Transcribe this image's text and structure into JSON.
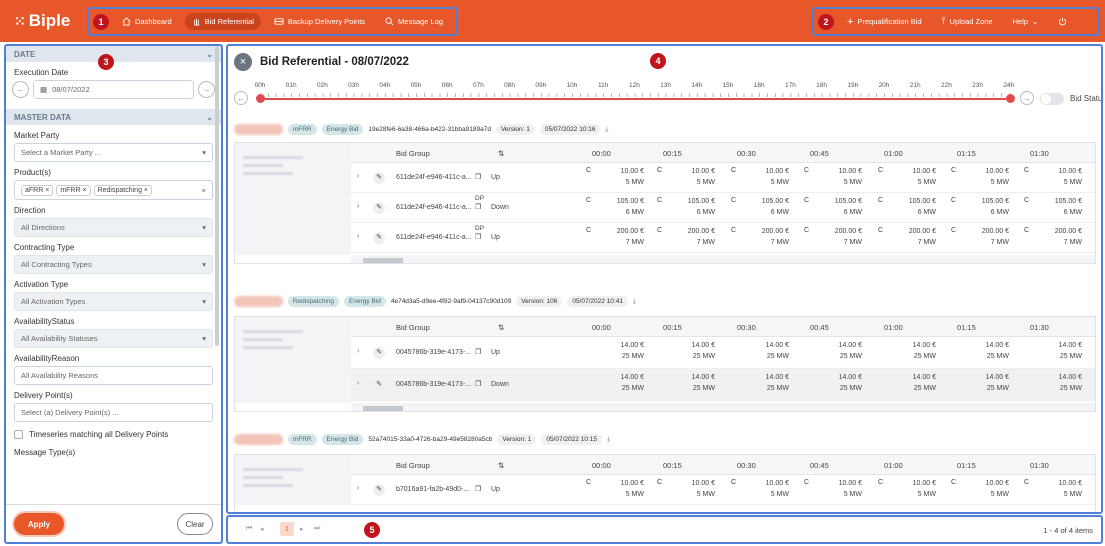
{
  "app": {
    "logo": "Biple",
    "accent": "#e8572a",
    "highlight": "#4f7fd8"
  },
  "nav_left": [
    {
      "label": "Dashboard",
      "icon": "home-icon",
      "active": false
    },
    {
      "label": "Bid Referential",
      "icon": "hand-icon",
      "active": true
    },
    {
      "label": "Backup Delivery Points",
      "icon": "truck-icon",
      "active": false
    },
    {
      "label": "Message Log",
      "icon": "search-icon",
      "active": false
    }
  ],
  "nav_right": [
    {
      "label": "Prequalification Bid",
      "icon": "plus-icon"
    },
    {
      "label": "Upload Zone",
      "icon": "upload-icon"
    },
    {
      "label": "Help",
      "icon": "chevron-down-icon"
    }
  ],
  "markers": [
    "1",
    "2",
    "3",
    "4",
    "5"
  ],
  "sidebar": {
    "date_section": "DATE",
    "execution_date_label": "Execution Date",
    "execution_date": "08/07/2022",
    "master_section": "MASTER DATA",
    "market_party_label": "Market Party",
    "market_party_placeholder": "Select a Market Party ...",
    "products_label": "Product(s)",
    "products": [
      "aFRR",
      "mFRR",
      "Redispatching"
    ],
    "direction_label": "Direction",
    "direction_value": "All Directions",
    "contracting_label": "Contracting Type",
    "contracting_value": "All Contracting Types",
    "activation_label": "Activation Type",
    "activation_value": "All Activation Types",
    "availability_status_label": "AvailabilityStatus",
    "availability_status_value": "All Availability Statuses",
    "availability_reason_label": "AvailabilityReason",
    "availability_reason_value": "All Availability Reasons",
    "delivery_label": "Delivery Point(s)",
    "delivery_placeholder": "Select (a) Delivery Point(s) ...",
    "timeseries_label": "Timeseries matching all Delivery Points",
    "message_type_label": "Message Type(s)",
    "apply": "Apply",
    "clear": "Clear"
  },
  "main": {
    "title": "Bid Referential - 08/07/2022",
    "hours": [
      "00h",
      "01h",
      "02h",
      "03h",
      "04h",
      "05h",
      "06h",
      "07h",
      "08h",
      "09h",
      "10h",
      "11h",
      "12h",
      "13h",
      "14h",
      "15h",
      "16h",
      "17h",
      "18h",
      "19h",
      "20h",
      "21h",
      "22h",
      "23h",
      "24h"
    ],
    "bid_status_label": "Bid Status",
    "columns": {
      "group": "Bid Group",
      "sort": "⇅",
      "times": [
        "00:00",
        "00:15",
        "00:30",
        "00:45",
        "01:00",
        "01:15",
        "01:30"
      ]
    },
    "bids": [
      {
        "tags": [
          "mFRR",
          "Energy Bid"
        ],
        "id": "19e28fe6-6a38-466a-b422-31bba9189a7d",
        "version": "Version: 1",
        "timestamp": "05/07/2022 10:16",
        "rows": [
          {
            "group": "611de24f-e946-411c-a...",
            "dp": "",
            "dir": "Up",
            "c": "C",
            "price": "10.00 €",
            "vol": "5 MW"
          },
          {
            "group": "611de24f-e946-411c-a...",
            "dp": "DP",
            "dir": "Down",
            "c": "C",
            "price": "105.00 €",
            "vol": "6 MW"
          },
          {
            "group": "611de24f-e946-411c-a...",
            "dp": "DP",
            "dir": "Up",
            "c": "C",
            "price": "200.00 €",
            "vol": "7 MW"
          }
        ]
      },
      {
        "tags": [
          "Redispatching",
          "Energy Bid"
        ],
        "id": "4e74d3a5-d9ee-4f82-9af9-04137c90d109",
        "version": "Version: 106",
        "timestamp": "05/07/2022 10:41",
        "rows": [
          {
            "group": "0045786b-319e-4173-...",
            "dp": "",
            "dir": "Up",
            "c": "",
            "price": "14.00 €",
            "vol": "25 MW"
          },
          {
            "group": "0045786b-319e-4173-...",
            "dp": "",
            "dir": "Down",
            "c": "",
            "price": "14.00 €",
            "vol": "25 MW"
          }
        ]
      },
      {
        "tags": [
          "mFRR",
          "Energy Bid"
        ],
        "id": "52a74015-33a0-4726-ba29-49e58280a5cb",
        "version": "Version: 1",
        "timestamp": "05/07/2022 10:15",
        "rows": [
          {
            "group": "b7016a91-fa2b-49d0-...",
            "dp": "",
            "dir": "Up",
            "c": "C",
            "price": "10.00 €",
            "vol": "5 MW"
          }
        ]
      }
    ]
  },
  "pager": {
    "page": "1",
    "count": "1 - 4 of 4 items"
  }
}
